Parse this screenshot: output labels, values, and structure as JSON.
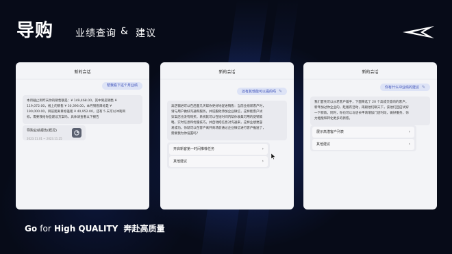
{
  "header": {
    "title": "导购",
    "subtitle": "业绩查询",
    "amp": "&",
    "subtitle2": "建议"
  },
  "footer": {
    "slogan_prefix": "Go",
    "slogan_for": "for",
    "slogan_hq": "High QUALITY",
    "slogan_cn": "奔赴高质量"
  },
  "cards": [
    {
      "title": "新的会话",
      "user_message": "帮我看下这个月业绩",
      "bot_lines": [
        "本月截止到昨天你的销售额是：¥ 149,468.00，其中到店销售 ¥",
        "119,072.00，线上的销售 ¥ 30,396.00，本月销售目标是 ¥",
        "190,000.00，目前距离目标差距 ¥ 40,952.00，还有 5 天可以冲刺目",
        "标，需要我给你些建议方案吗，具体请查看以下报告"
      ],
      "report": {
        "title": "导购业绩报告(概况)",
        "date": "2023.11.01 ~ 2023.11.25"
      }
    },
    {
      "title": "新的会话",
      "user_message": "还有其他能可以提的吗",
      "bot_lines": [
        "高店铺进可以在后面几天帮你更好地促进销售：当前业绩新客户时，",
        "请与用户做好沟通和服务，并说服他添加企业微信，这样能客户试",
        "穿案店也没有购买。系统就可以在短时间内帮你收集可用的促销策",
        "略，实时信息和优服技巧，并自动把信息对沟通来，这样业绩更容",
        "易成功，你就可以在客户离开商场前通过企业微信进行客户推送了，",
        "需要我为你设置吗？"
      ],
      "options": [
        "开启新客第一时间推荐任务",
        "其他建议"
      ]
    },
    {
      "title": "新的会话",
      "user_message": "你有什么冲业绩的建议",
      "bot_lines": [
        "我们首先可以从老客户着手，下面筛选了 20 个高成交意向的客户，",
        "新年加过你企业的，趁着有活动，再跟他们聊天下，该他们回店试穿",
        "一下新款。同时，你也可以与店长申请增加门店时段，做好服务，你",
        "力继能和转化更多的新客。"
      ],
      "options": [
        "展示高潜客户列表",
        "其他建议"
      ]
    }
  ]
}
